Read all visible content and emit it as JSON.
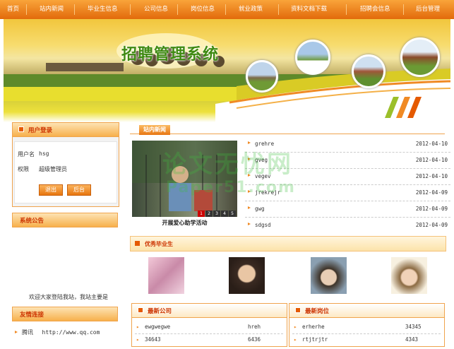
{
  "nav": {
    "items": [
      "首页",
      "站内新闻",
      "毕业生信息",
      "公司信息",
      "岗位信息",
      "就业政策",
      "资料文档下载",
      "招聘会信息",
      "后台管理"
    ]
  },
  "banner": {
    "title": "招聘管理系统"
  },
  "login": {
    "title": "用户登录",
    "username_label": "用户名",
    "username_value": "hsg",
    "role_label": "权限",
    "role_value": "超级管理员",
    "logout_label": "退出",
    "admin_label": "后台"
  },
  "notice": {
    "title": "系统公告",
    "text": "欢迎大家登陆我站，我站主要是"
  },
  "links": {
    "title": "友情连接",
    "items": [
      {
        "name": "腾讯",
        "url": "http://www.qq.com"
      }
    ]
  },
  "news": {
    "tab": "站内新闻",
    "photo_caption": "开展爱心助学活动",
    "pages": [
      "1",
      "2",
      "3",
      "4",
      "5"
    ],
    "items": [
      {
        "title": "grehre",
        "date": "2012-04-10"
      },
      {
        "title": "gveg",
        "date": "2012-04-10"
      },
      {
        "title": "vegev",
        "date": "2012-04-10"
      },
      {
        "title": "jrekrejr",
        "date": "2012-04-09"
      },
      {
        "title": "gwg",
        "date": "2012-04-09"
      },
      {
        "title": "sdgsd",
        "date": "2012-04-09"
      }
    ]
  },
  "graduates": {
    "title": "优秀毕业生"
  },
  "companies": {
    "title": "最新公司",
    "rows": [
      {
        "name": "ewgwegwe",
        "value": "hreh"
      },
      {
        "name": "34643",
        "value": "6436"
      }
    ]
  },
  "jobs": {
    "title": "最新岗位",
    "rows": [
      {
        "name": "erherhe",
        "value": "34345"
      },
      {
        "name": "rtjtrjtr",
        "value": "4343"
      }
    ]
  },
  "watermark": {
    "line1": "论文无忧网",
    "line2": "Paper51.com"
  },
  "colors": {
    "nav_orange": "#e8760f",
    "accent_red": "#cc3300",
    "border_orange": "#f0a44d"
  }
}
